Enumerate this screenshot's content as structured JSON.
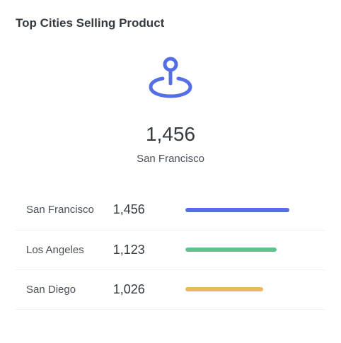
{
  "card": {
    "title": "Top Cities Selling Product"
  },
  "hero": {
    "icon": "map-pin-icon",
    "icon_color": "#556ee6",
    "value": "1,456",
    "city": "San Francisco"
  },
  "cities": [
    {
      "name": "San Francisco",
      "value": "1,456",
      "progress": 0.98,
      "color": "#556ee6"
    },
    {
      "name": "Los Angeles",
      "value": "1,123",
      "progress": 0.86,
      "color": "#5fc38f"
    },
    {
      "name": "San Diego",
      "value": "1,026",
      "progress": 0.73,
      "color": "#e9b95c"
    }
  ]
}
